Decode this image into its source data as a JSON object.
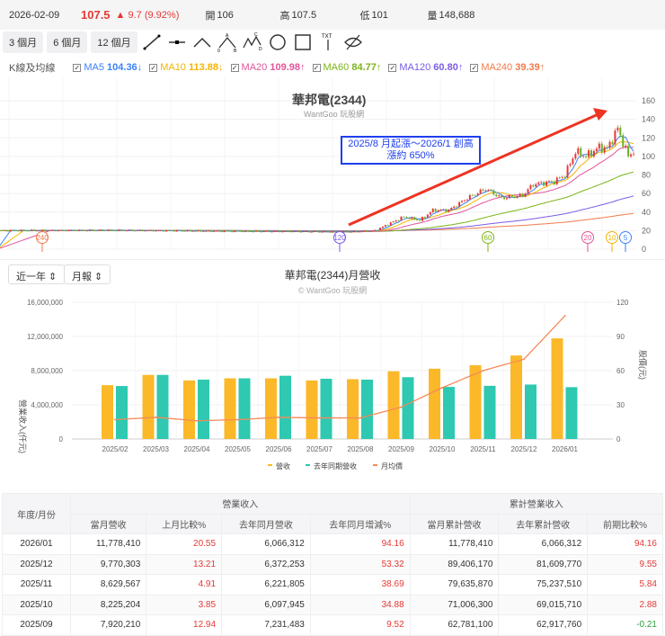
{
  "quote": {
    "date": "2026-02-09",
    "price": "107.5",
    "change": "▲ 9.7 (9.92%)",
    "open_label": "開",
    "open": "106",
    "high_label": "高",
    "high": "107.5",
    "low_label": "低",
    "low": "101",
    "vol_label": "量",
    "vol": "148,688"
  },
  "periods": [
    "3 個月",
    "6 個月",
    "12 個月"
  ],
  "ma_legend": {
    "title": "K線及均線",
    "items": [
      {
        "name": "MA5",
        "value": "104.36",
        "arrow": "↓",
        "color": "#3b82f6"
      },
      {
        "name": "MA10",
        "value": "113.88",
        "arrow": "↓",
        "color": "#f4b400"
      },
      {
        "name": "MA20",
        "value": "109.98",
        "arrow": "↑",
        "color": "#e0559a"
      },
      {
        "name": "MA60",
        "value": "84.77",
        "arrow": "↑",
        "color": "#7cb518"
      },
      {
        "name": "MA120",
        "value": "60.80",
        "arrow": "↑",
        "color": "#7b5be6"
      },
      {
        "name": "MA240",
        "value": "39.39",
        "arrow": "↑",
        "color": "#f07a4a"
      }
    ]
  },
  "kchart": {
    "title": "華邦電(2344)",
    "subtitle": "WantGoo 玩股網",
    "annotation_line1": "2025/8 月起漲～2026/1 創高",
    "annotation_line2": "漲約 650%",
    "y_ticks": [
      "0",
      "20",
      "40",
      "60",
      "80",
      "100",
      "120",
      "140",
      "160"
    ],
    "ma_markers": [
      "240",
      "120",
      "60",
      "20",
      "10",
      "5"
    ],
    "price_keypoints": [
      [
        0,
        20
      ],
      [
        40,
        20.5
      ],
      [
        80,
        19.5
      ],
      [
        110,
        19
      ],
      [
        129,
        18.5
      ],
      [
        142,
        20
      ],
      [
        153,
        35
      ],
      [
        159,
        31
      ],
      [
        164,
        42
      ],
      [
        170,
        42
      ],
      [
        177,
        55
      ],
      [
        184,
        65
      ],
      [
        190,
        55
      ],
      [
        198,
        58
      ],
      [
        202,
        70
      ],
      [
        210,
        73
      ],
      [
        214,
        80
      ],
      [
        218,
        105
      ],
      [
        222,
        100
      ],
      [
        227,
        110
      ],
      [
        230,
        108
      ],
      [
        234,
        130
      ],
      [
        236,
        115
      ],
      [
        238,
        100
      ],
      [
        240,
        106
      ]
    ]
  },
  "revenue_chart": {
    "title": "華邦電(2344)月營收",
    "subtitle": "© WantGoo 玩股網",
    "range_select": "近一年",
    "type_select": "月報",
    "ylabel_left": "營業收入(仟元)",
    "ylabel_right": "股價(元)",
    "y_left_ticks": [
      "0",
      "4,000,000",
      "8,000,000",
      "12,000,000",
      "16,000,000"
    ],
    "y_right_ticks": [
      "0",
      "30",
      "60",
      "90",
      "120"
    ],
    "legend": [
      "營收",
      "去年同期營收",
      "月均價"
    ]
  },
  "chart_data": {
    "type": "bar",
    "title": "華邦電(2344)月營收",
    "categories": [
      "2025/02",
      "2025/03",
      "2025/04",
      "2025/05",
      "2025/06",
      "2025/07",
      "2025/08",
      "2025/09",
      "2025/10",
      "2025/11",
      "2025/12",
      "2026/01"
    ],
    "ylim": [
      0,
      16000000
    ],
    "y2lim": [
      0,
      120
    ],
    "series": [
      {
        "name": "營收",
        "type": "bar",
        "color": "#fbb829",
        "values": [
          6300000,
          7500000,
          6850000,
          7100000,
          7100000,
          6850000,
          7000000,
          7920210,
          8225204,
          8629567,
          9770303,
          11778410
        ]
      },
      {
        "name": "去年同期營收",
        "type": "bar",
        "color": "#2ec9b0",
        "values": [
          6200000,
          7500000,
          6950000,
          7100000,
          7400000,
          7050000,
          6950000,
          7231483,
          6097945,
          6221805,
          6372253,
          6066312
        ]
      },
      {
        "name": "月均價",
        "type": "line",
        "color": "#f58a5a",
        "values": [
          17,
          19,
          16,
          17,
          19,
          18.5,
          18.5,
          28,
          45,
          60,
          70,
          108
        ]
      }
    ]
  },
  "table": {
    "h_period": "年度/月份",
    "h_group1": "營業收入",
    "h_group2": "累計營業收入",
    "cols": [
      "當月營收",
      "上月比較%",
      "去年同月營收",
      "去年同月增減%",
      "當月累計營收",
      "去年累計營收",
      "前期比較%"
    ],
    "rows": [
      [
        "2026/01",
        "11,778,410",
        "20.55",
        "6,066,312",
        "94.16",
        "11,778,410",
        "6,066,312",
        "94.16"
      ],
      [
        "2025/12",
        "9,770,303",
        "13.21",
        "6,372,253",
        "53.32",
        "89,406,170",
        "81,609,770",
        "9.55"
      ],
      [
        "2025/11",
        "8,629,567",
        "4.91",
        "6,221,805",
        "38.69",
        "79,635,870",
        "75,237,510",
        "5.84"
      ],
      [
        "2025/10",
        "8,225,204",
        "3.85",
        "6,097,945",
        "34.88",
        "71,006,300",
        "69,015,710",
        "2.88"
      ],
      [
        "2025/09",
        "7,920,210",
        "12.94",
        "7,231,483",
        "9.52",
        "62,781,100",
        "62,917,760",
        "-0.21"
      ]
    ]
  }
}
